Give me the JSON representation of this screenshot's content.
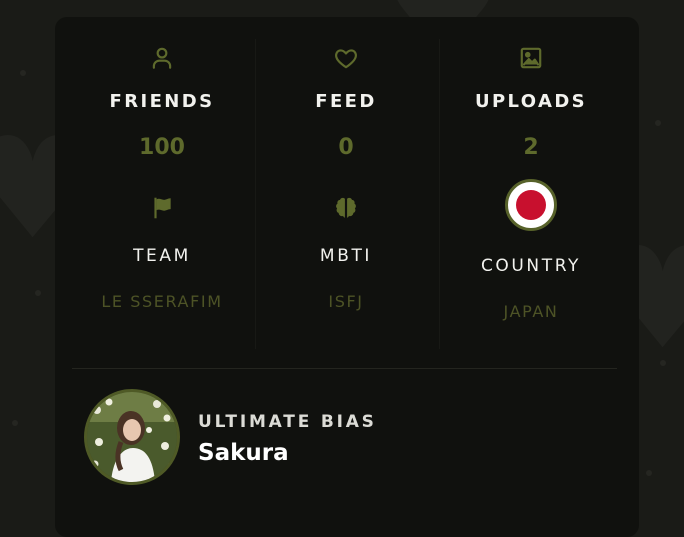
{
  "stats": [
    {
      "icon": "user-icon",
      "title": "FRIENDS",
      "value": "100"
    },
    {
      "icon": "heart-icon",
      "title": "FEED",
      "value": "0"
    },
    {
      "icon": "image-icon",
      "title": "UPLOADS",
      "value": "2"
    }
  ],
  "profile_facts": [
    {
      "icon": "flag-icon",
      "title": "TEAM",
      "value": "LE SSERAFIM"
    },
    {
      "icon": "brain-icon",
      "title": "MBTI",
      "value": "ISFJ"
    },
    {
      "icon": "japan-flag-icon",
      "title": "COUNTRY",
      "value": "JAPAN"
    }
  ],
  "bias": {
    "label": "ULTIMATE BIAS",
    "name": "Sakura"
  },
  "colors": {
    "accent": "#5e6a2c",
    "accent_muted": "#4d5326",
    "card_background": "#10110e",
    "page_background": "#1a1b17",
    "flag_red": "#c8102e"
  }
}
